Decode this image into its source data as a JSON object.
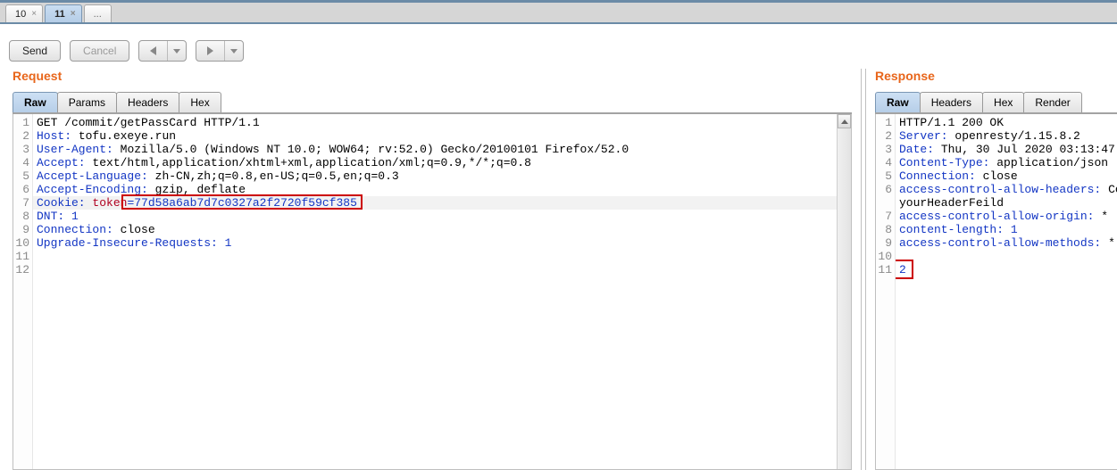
{
  "tabs": [
    "10",
    "11",
    "..."
  ],
  "active_tab_index": 1,
  "toolbar": {
    "send": "Send",
    "cancel": "Cancel"
  },
  "request": {
    "title": "Request",
    "subtabs": [
      "Raw",
      "Params",
      "Headers",
      "Hex"
    ],
    "active_subtab": 0,
    "lines": [
      {
        "type": "start",
        "text": "GET /commit/getPassCard HTTP/1.1"
      },
      {
        "type": "header",
        "name": "Host",
        "value": "tofu.exeye.run"
      },
      {
        "type": "header",
        "name": "User-Agent",
        "value": "Mozilla/5.0 (Windows NT 10.0; WOW64; rv:52.0) Gecko/20100101 Firefox/52.0"
      },
      {
        "type": "header",
        "name": "Accept",
        "value": "text/html,application/xhtml+xml,application/xml;q=0.9,*/*;q=0.8"
      },
      {
        "type": "header",
        "name": "Accept-Language",
        "value": "zh-CN,zh;q=0.8,en-US;q=0.5,en;q=0.3"
      },
      {
        "type": "header",
        "name": "Accept-Encoding",
        "value": "gzip, deflate"
      },
      {
        "type": "cookie",
        "name": "Cookie",
        "key": "token",
        "val": "77d58a6ab7d7c0327a2f2720f59cf385",
        "highlight_value": true
      },
      {
        "type": "header",
        "name": "DNT",
        "value": "1",
        "numeric": true
      },
      {
        "type": "header",
        "name": "Connection",
        "value": "close"
      },
      {
        "type": "header",
        "name": "Upgrade-Insecure-Requests",
        "value": "1",
        "numeric": true
      },
      {
        "type": "blank"
      },
      {
        "type": "blank"
      }
    ]
  },
  "response": {
    "title": "Response",
    "subtabs": [
      "Raw",
      "Headers",
      "Hex",
      "Render"
    ],
    "active_subtab": 0,
    "lines": [
      {
        "type": "start",
        "text": "HTTP/1.1 200 OK"
      },
      {
        "type": "header",
        "name": "Server",
        "value": "openresty/1.15.8.2"
      },
      {
        "type": "header",
        "name": "Date",
        "value": "Thu, 30 Jul 2020 03:13:47"
      },
      {
        "type": "header",
        "name": "Content-Type",
        "value": "application/json"
      },
      {
        "type": "header",
        "name": "Connection",
        "value": "close"
      },
      {
        "type": "header-wrap",
        "name": "access-control-allow-headers",
        "value": "Content-Type,",
        "cont": "yourHeaderFeild"
      },
      {
        "type": "header",
        "name": "access-control-allow-origin",
        "value": "*"
      },
      {
        "type": "header",
        "name": "content-length",
        "value": "1",
        "numeric": true
      },
      {
        "type": "header",
        "name": "access-control-allow-methods",
        "value": "*"
      },
      {
        "type": "blank"
      },
      {
        "type": "body-num",
        "text": "2",
        "highlight": true
      }
    ]
  }
}
